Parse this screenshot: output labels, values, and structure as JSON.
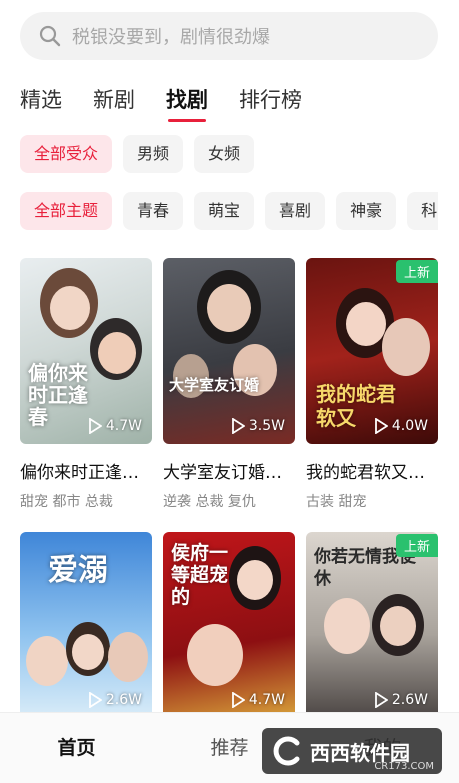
{
  "search": {
    "placeholder": "税银没要到，剧情很劲爆",
    "icon": "search-icon"
  },
  "tabs": [
    {
      "label": "精选",
      "active": false
    },
    {
      "label": "新剧",
      "active": false
    },
    {
      "label": "找剧",
      "active": true
    },
    {
      "label": "排行榜",
      "active": false
    }
  ],
  "audience_filters": [
    "全部受众",
    "男频",
    "女频"
  ],
  "theme_filters": [
    "全部主题",
    "青春",
    "萌宝",
    "喜剧",
    "神豪",
    "科"
  ],
  "dramas": [
    {
      "title": "偏你来时正逢…",
      "tags": "甜宠 都市 总裁",
      "views": "4.7W",
      "badge": "",
      "poster_text": "偏你来时正逢春"
    },
    {
      "title": "大学室友订婚…",
      "tags": "逆袭 总裁 复仇",
      "views": "3.5W",
      "badge": "",
      "poster_text": "大学室友订婚"
    },
    {
      "title": "我的蛇君软又…",
      "tags": "古装 甜宠",
      "views": "4.0W",
      "badge": "上新",
      "poster_text": "我的蛇君软又"
    },
    {
      "title": "",
      "tags": "",
      "views": "2.6W",
      "badge": "",
      "poster_text": "爱溺"
    },
    {
      "title": "",
      "tags": "",
      "views": "4.7W",
      "badge": "",
      "poster_text": "侯府一等超宠的"
    },
    {
      "title": "",
      "tags": "",
      "views": "2.6W",
      "badge": "上新",
      "poster_text": "你若无情我便休"
    }
  ],
  "bottom_nav": [
    {
      "label": "首页",
      "active": true
    },
    {
      "label": "推荐",
      "active": false
    },
    {
      "label": "我的",
      "active": false
    }
  ],
  "watermark": {
    "text": "西西软件园",
    "url": "CR173.COM"
  },
  "colors": {
    "accent": "#e8203b",
    "badge": "#2ac16e",
    "chip_active_bg": "#fde6ea"
  }
}
